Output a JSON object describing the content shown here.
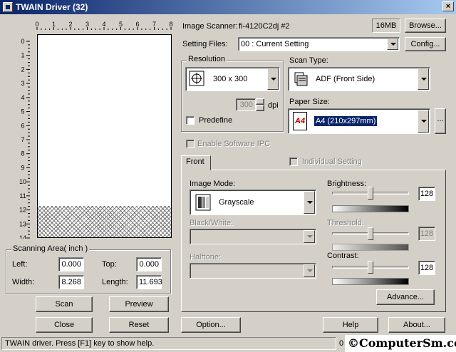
{
  "window": {
    "title": "TWAIN Driver (32)",
    "close_glyph": "×"
  },
  "scanner": {
    "label": "Image Scanner:",
    "value": "fi-4120C2dj #2",
    "memory": "16MB",
    "browse_label": "Browse..."
  },
  "setting_files": {
    "label": "Setting Files:",
    "value": "00 : Current Setting",
    "config_label": "Config..."
  },
  "resolution": {
    "group_label": "Resolution",
    "value": "300 x 300",
    "dpi_value": "300",
    "dpi_unit": "dpi",
    "predefine_label": "Predefine"
  },
  "scan_type": {
    "label": "Scan Type:",
    "value": "ADF (Front Side)"
  },
  "paper_size": {
    "label": "Paper Size:",
    "value": "A4 (210x297mm)",
    "icon_text": "A4",
    "more_label": "..."
  },
  "ipc": {
    "enable_label": "Enable Software IPC",
    "individual_label": "Individual Setting"
  },
  "tabs": [
    {
      "label": "Front"
    }
  ],
  "image_mode": {
    "label": "Image Mode:",
    "value": "Grayscale"
  },
  "black_white": {
    "label": "Black/White:"
  },
  "halftone": {
    "label": "Halftone:"
  },
  "brightness": {
    "label": "Brightness:",
    "value": "128",
    "level": 0.5
  },
  "threshold": {
    "label": "Threshold:",
    "value": "128",
    "level": 0.5
  },
  "contrast": {
    "label": "Contrast:",
    "value": "128",
    "level": 0.5
  },
  "advance_label": "Advance...",
  "ruler": {
    "top_ticks": [
      "0",
      "1",
      "2",
      "3",
      "4",
      "5",
      "6",
      "7",
      "8"
    ],
    "left_ticks": [
      "0",
      "1",
      "2",
      "3",
      "4",
      "5",
      "6",
      "7",
      "8",
      "9",
      "10",
      "11",
      "12",
      "13",
      "14"
    ]
  },
  "scanning_area": {
    "group_label": "Scanning Area( inch )",
    "left_label": "Left:",
    "left_value": "0.000",
    "top_label": "Top:",
    "top_value": "0.000",
    "width_label": "Width:",
    "width_value": "8.268",
    "length_label": "Length:",
    "length_value": "11.693"
  },
  "buttons": {
    "scan": "Scan",
    "preview": "Preview",
    "close": "Close",
    "reset": "Reset",
    "option": "Option...",
    "help": "Help",
    "about": "About..."
  },
  "status": {
    "text": "TWAIN driver. Press [F1] key to show help.",
    "extra": "0"
  },
  "watermark": "©ComputerSm.com",
  "icons": {
    "resolution": "scanner-resolution-icon",
    "scan_type": "adf-scanner-icon",
    "paper": "paper-a4-icon",
    "image_mode": "grayscale-mode-icon"
  }
}
